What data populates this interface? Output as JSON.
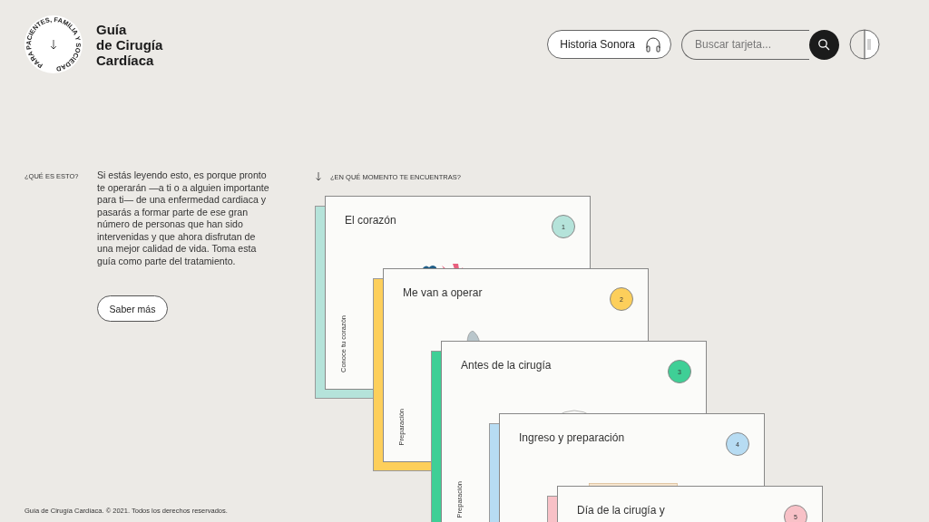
{
  "logo": {
    "ring_text": "PARA PACIENTES, FAMILIA Y SOCIEDAD",
    "title_lines": [
      "Guía",
      "de Cirugía",
      "Cardíaca"
    ]
  },
  "header": {
    "audio_button": "Historia Sonora",
    "search": {
      "placeholder": "Buscar tarjeta..."
    }
  },
  "intro": {
    "label": "¿QUÉ ES ESTO?",
    "text": "Si estás leyendo esto, es porque pronto te operarán —a ti o a alguien importante para ti— de una enfermedad cardiaca y pasarás a formar parte de ese gran número de personas que han sido intervenidas y que ahora disfrutan de una mejor calidad de vida. Toma esta guía como parte del tratamiento.",
    "button": "Saber más"
  },
  "stages": {
    "label": "¿EN QUÉ MOMENTO TE ENCUENTRAS?",
    "cards": [
      {
        "title": "El corazón",
        "number": "1",
        "color": "#b5e3da",
        "side_label": "Conoce tu corazón"
      },
      {
        "title": "Me van a operar",
        "number": "2",
        "color": "#fdcf5b",
        "side_label": "Preparación"
      },
      {
        "title": "Antes de la cirugía",
        "number": "3",
        "color": "#3fcf96",
        "side_label": "Preparación"
      },
      {
        "title": "Ingreso y preparación",
        "number": "4",
        "color": "#b7dcf3"
      },
      {
        "title": "Día de la cirugía y",
        "number": "5",
        "color": "#f8c1c7"
      }
    ]
  },
  "footer": "Guía de Cirugía Cardíaca. © 2021. Todos los derechos reservados."
}
